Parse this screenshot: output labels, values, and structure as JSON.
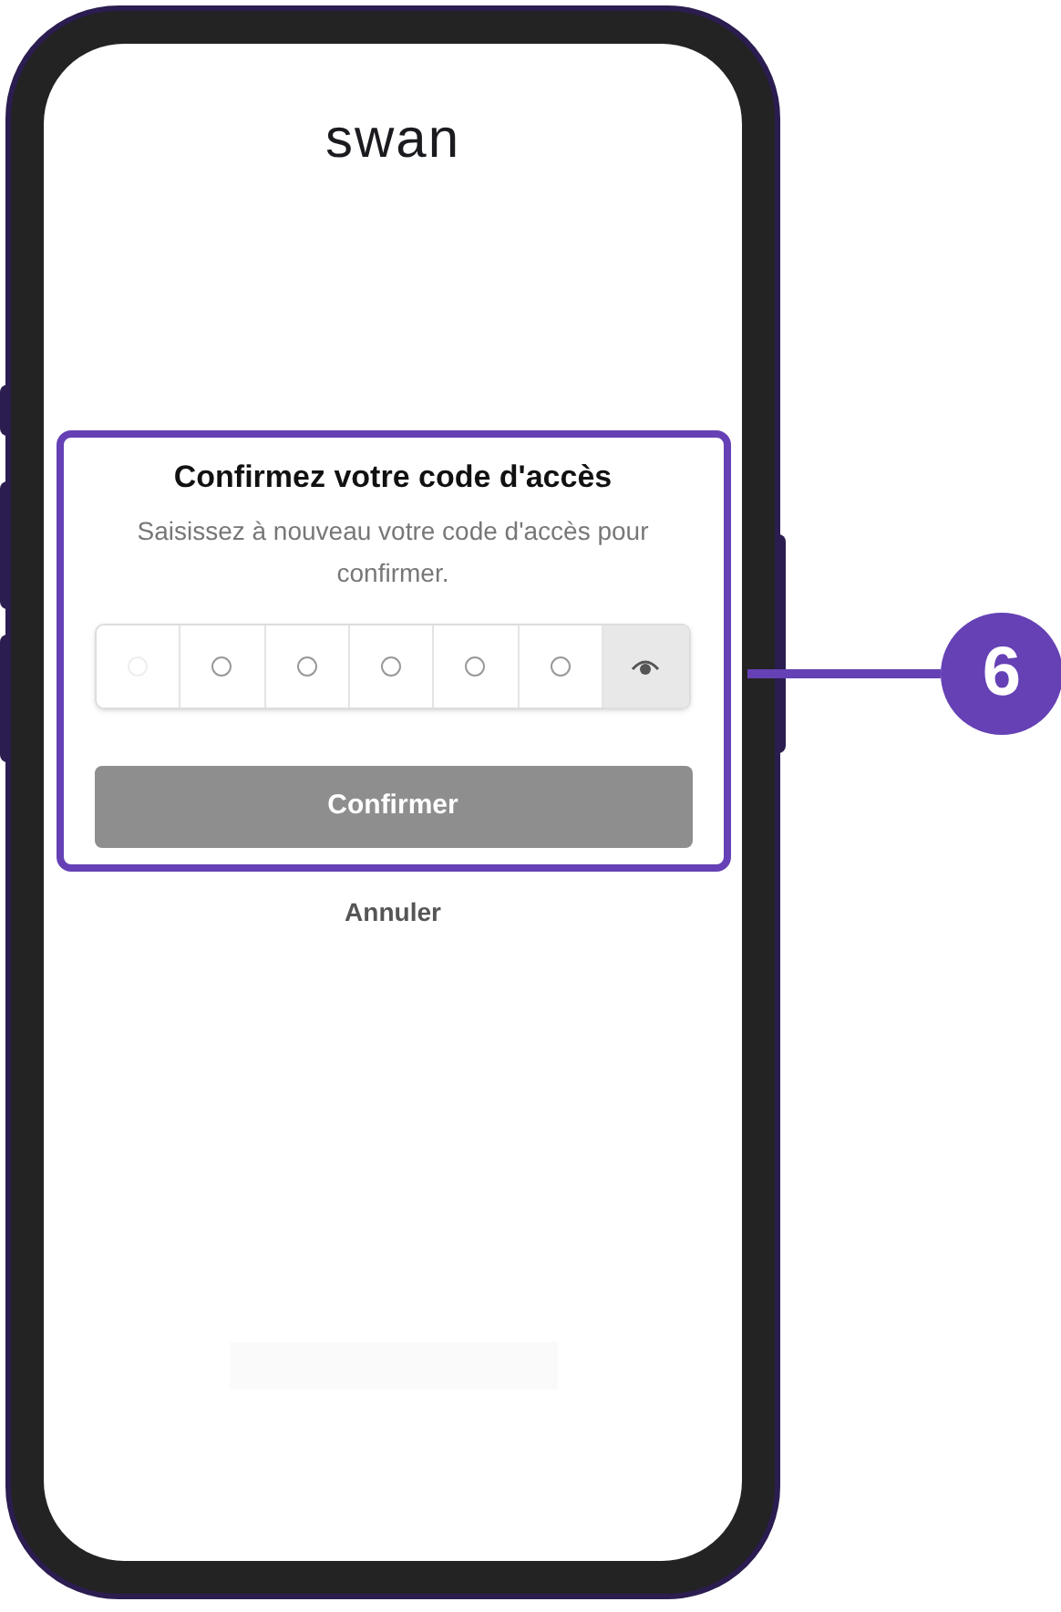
{
  "logo": "swan",
  "callout": {
    "number": "6"
  },
  "dialog": {
    "title": "Confirmez votre code d'accès",
    "subtitle": "Saisissez à nouveau votre code d'accès pour confirmer.",
    "pin_digits": [
      {
        "dim": true
      },
      {
        "dim": false
      },
      {
        "dim": false
      },
      {
        "dim": false
      },
      {
        "dim": false
      },
      {
        "dim": false
      }
    ],
    "confirm_button": {
      "label": "Confirmer",
      "disabled": true
    }
  },
  "cancel_link": "Annuler"
}
